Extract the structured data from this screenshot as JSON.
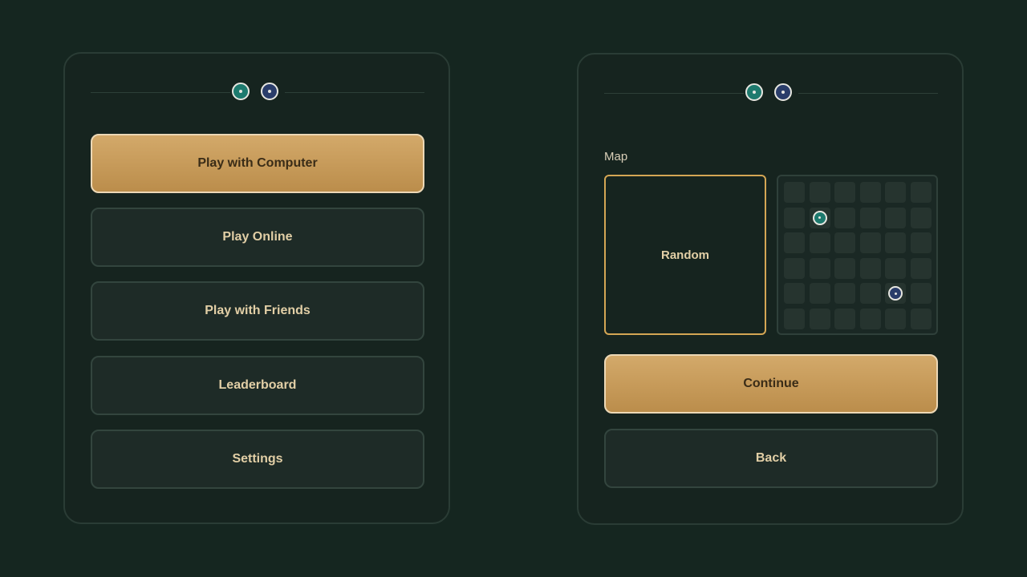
{
  "menu": {
    "buttons": [
      {
        "label": "Play with Computer",
        "style": "primary"
      },
      {
        "label": "Play Online",
        "style": "secondary"
      },
      {
        "label": "Play with Friends",
        "style": "secondary"
      },
      {
        "label": "Leaderboard",
        "style": "secondary"
      },
      {
        "label": "Settings",
        "style": "secondary"
      }
    ]
  },
  "players": [
    {
      "color": "#1e7a6e",
      "icon": "teal-player-token-icon"
    },
    {
      "color": "#2a3d6a",
      "icon": "navy-player-token-icon"
    }
  ],
  "map_select": {
    "label": "Map",
    "random_label": "Random",
    "random_selected": true,
    "grid": {
      "rows": 6,
      "cols": 6,
      "tokens": [
        {
          "player": "teal",
          "row": 2,
          "col": 2
        },
        {
          "player": "navy",
          "row": 5,
          "col": 5
        }
      ]
    },
    "continue_label": "Continue",
    "back_label": "Back"
  },
  "colors": {
    "background": "#152620",
    "accent_gold": "#d4a654",
    "text_cream": "#e2cfa6"
  }
}
